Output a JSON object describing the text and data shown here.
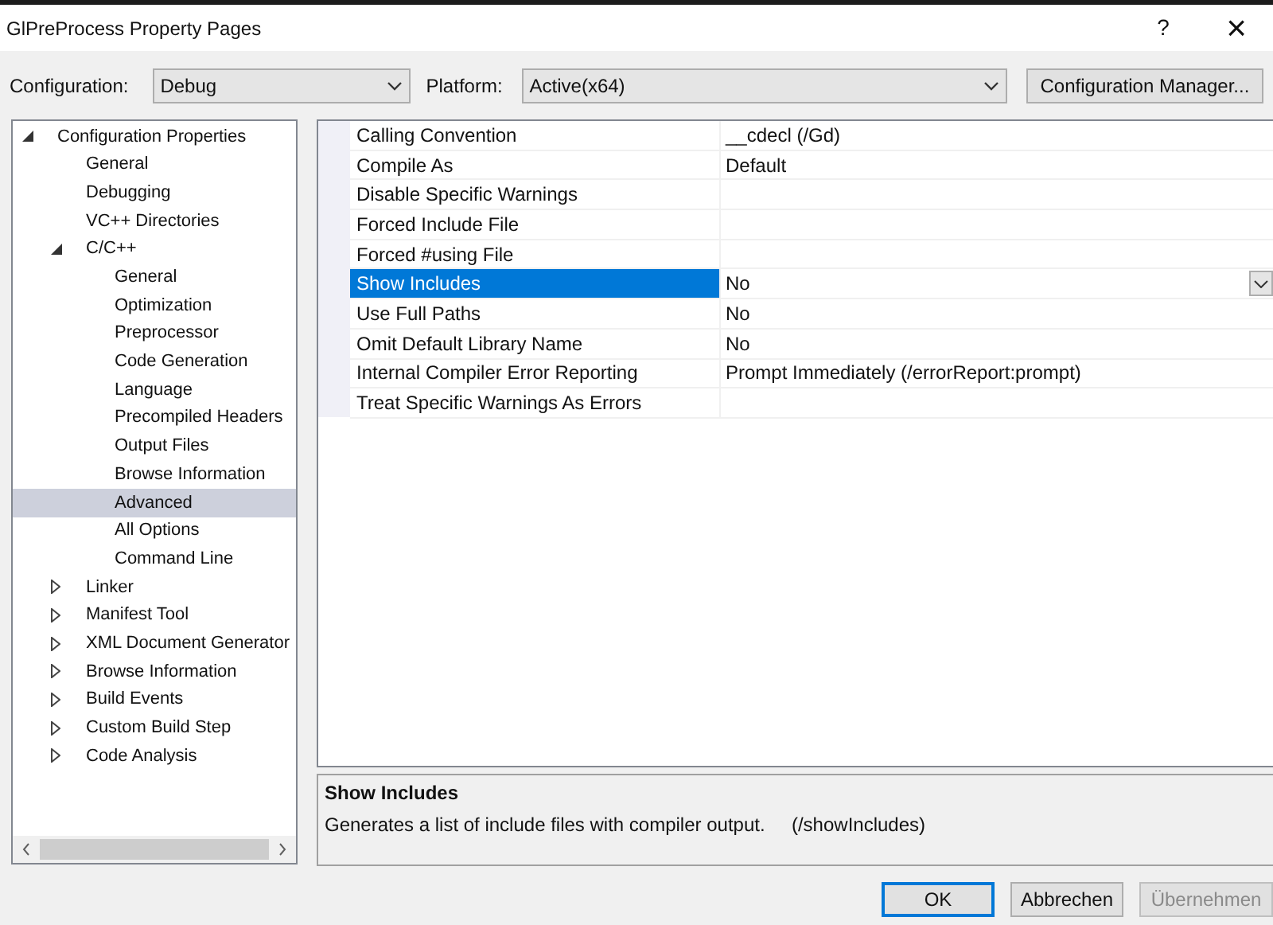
{
  "window": {
    "title": "GlPreProcess Property Pages",
    "help": "?",
    "close": "×"
  },
  "toolbar": {
    "configuration_label": "Configuration:",
    "configuration": "Debug",
    "platform_label": "Platform:",
    "platform": "Active(x64)",
    "manager_button": "Configuration Manager..."
  },
  "tree": [
    {
      "label": "Configuration Properties",
      "expanded": true,
      "selected": false,
      "children": [
        {
          "label": "General",
          "selected": false
        },
        {
          "label": "Debugging",
          "selected": false
        },
        {
          "label": "VC++ Directories",
          "selected": false
        },
        {
          "label": "C/C++",
          "expanded": true,
          "selected": false,
          "children": [
            {
              "label": "General",
              "selected": false
            },
            {
              "label": "Optimization",
              "selected": false
            },
            {
              "label": "Preprocessor",
              "selected": false
            },
            {
              "label": "Code Generation",
              "selected": false
            },
            {
              "label": "Language",
              "selected": false
            },
            {
              "label": "Precompiled Headers",
              "selected": false
            },
            {
              "label": "Output Files",
              "selected": false
            },
            {
              "label": "Browse Information",
              "selected": false
            },
            {
              "label": "Advanced",
              "selected": true
            },
            {
              "label": "All Options",
              "selected": false
            },
            {
              "label": "Command Line",
              "selected": false
            }
          ]
        },
        {
          "label": "Linker",
          "expanded": false,
          "selected": false
        },
        {
          "label": "Manifest Tool",
          "expanded": false,
          "selected": false
        },
        {
          "label": "XML Document Generator",
          "expanded": false,
          "selected": false
        },
        {
          "label": "Browse Information",
          "expanded": false,
          "selected": false
        },
        {
          "label": "Build Events",
          "expanded": false,
          "selected": false
        },
        {
          "label": "Custom Build Step",
          "expanded": false,
          "selected": false
        },
        {
          "label": "Code Analysis",
          "expanded": false,
          "selected": false
        }
      ]
    }
  ],
  "properties": [
    {
      "name": "Calling Convention",
      "value": "__cdecl (/Gd)",
      "selected": false
    },
    {
      "name": "Compile As",
      "value": "Default",
      "selected": false
    },
    {
      "name": "Disable Specific Warnings",
      "selected": false
    },
    {
      "name": "Forced Include File",
      "selected": false
    },
    {
      "name": "Forced #using File",
      "selected": false
    },
    {
      "name": "Show Includes",
      "value": "No",
      "selected": true
    },
    {
      "name": "Use Full Paths",
      "value": "No",
      "selected": false
    },
    {
      "name": "Omit Default Library Name",
      "value": "No",
      "selected": false
    },
    {
      "name": "Internal Compiler Error Reporting",
      "value": "Prompt Immediately (/errorReport:prompt)",
      "selected": false
    },
    {
      "name": "Treat Specific Warnings As Errors",
      "selected": false
    }
  ],
  "description": {
    "title": "Show Includes",
    "text": "Generates a list of include files with compiler output.     (/showIncludes)"
  },
  "buttons": [
    {
      "label": "OK",
      "kind": "default",
      "disabled": false
    },
    {
      "label": "Abbrechen",
      "kind": "normal",
      "disabled": false
    },
    {
      "label": "Übernehmen",
      "kind": "normal",
      "disabled": true
    }
  ]
}
